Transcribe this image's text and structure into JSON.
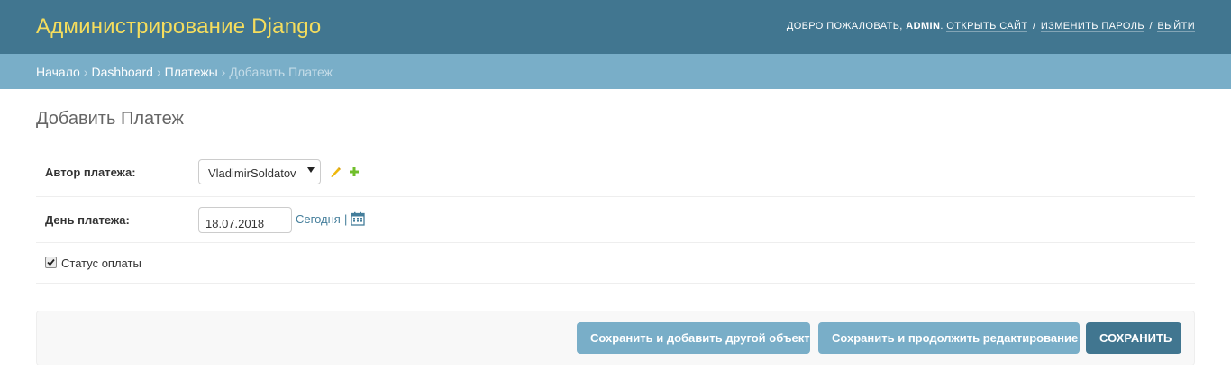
{
  "header": {
    "site_name": "Администрирование Django",
    "welcome": "Добро пожаловать,",
    "username": "admin",
    "view_site": "Открыть сайт",
    "change_password": "Изменить пароль",
    "logout": "Выйти",
    "separator": "/"
  },
  "breadcrumbs": {
    "home": "Начало",
    "dashboard": "Dashboard",
    "model": "Платежы",
    "current": "Добавить Платеж",
    "separator": "›"
  },
  "page": {
    "title": "Добавить Платеж"
  },
  "form": {
    "author": {
      "label": "Автор платежа:",
      "selected": "VladimirSoldatov",
      "edit_icon": "pencil-icon",
      "add_icon": "plus-icon"
    },
    "date": {
      "label": "День платежа:",
      "value": "18.07.2018",
      "today_link": "Сегодня",
      "separator": "|",
      "calendar_icon": "calendar-icon"
    },
    "status": {
      "label": "Статус оплаты",
      "checked": true
    }
  },
  "submit": {
    "save_add_another": "Сохранить и добавить другой объект",
    "save_continue": "Сохранить и продолжить редактирование",
    "save": "Сохранить"
  },
  "colors": {
    "header_bg": "#417690",
    "branding": "#f5dd5d",
    "breadcrumbs_bg": "#79aec8",
    "button_secondary": "#79aec8",
    "button_primary": "#417690",
    "link": "#447e9b"
  }
}
